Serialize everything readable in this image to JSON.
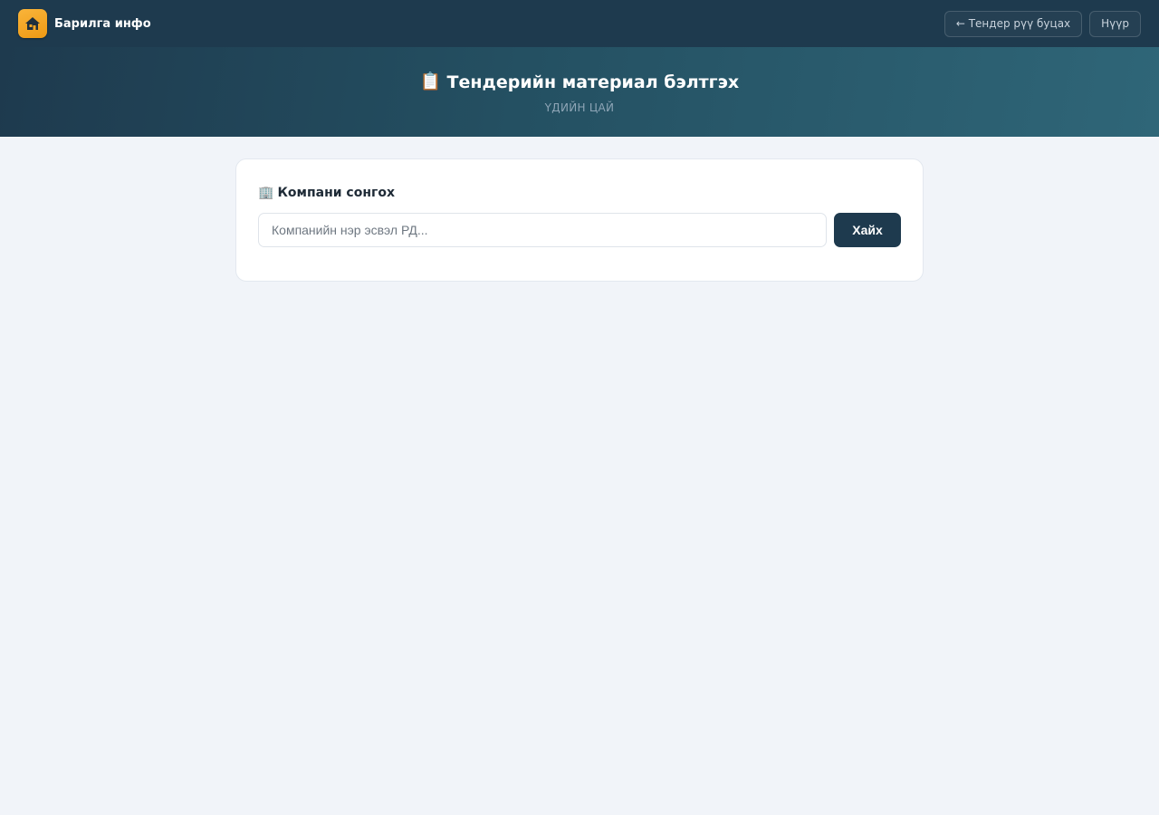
{
  "nav": {
    "brand_name": "Барилга инфо",
    "brand_icon": "house-icon",
    "back_button_label": "← Тендер рүү буцах",
    "home_button_label": "Нүүр"
  },
  "header": {
    "title_icon": "📋",
    "title": "Тендерийн материал бэлтгэх",
    "subtitle": "ҮДИЙН ЦАЙ"
  },
  "company_select": {
    "title_icon": "🏢",
    "title": "Компани сонгох",
    "search_placeholder": "Компанийн нэр эсвэл РД...",
    "search_value": "",
    "search_button_label": "Хайх"
  },
  "colors": {
    "navbar_bg": "#1e3a4e",
    "accent": "#f5a623",
    "page_bg": "#f1f4f9",
    "primary_button": "#1e3a4e"
  }
}
